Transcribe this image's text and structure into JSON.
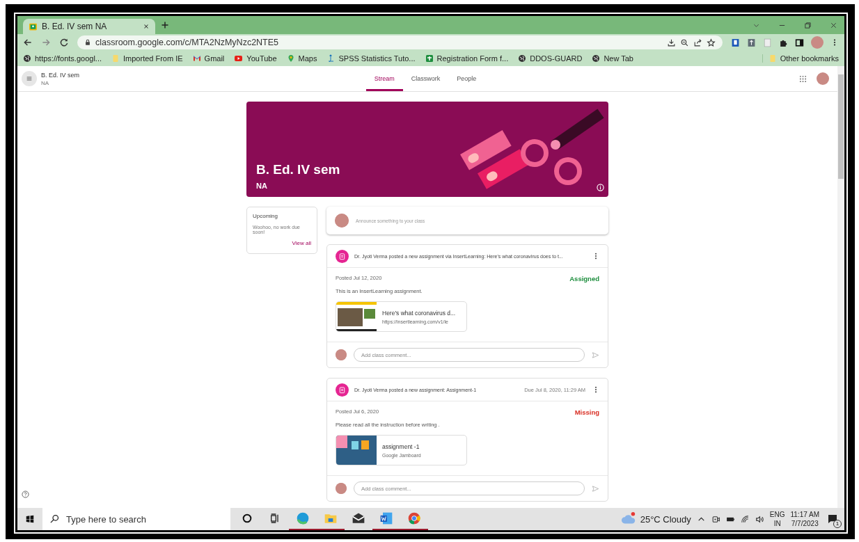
{
  "browser": {
    "tabs": [
      {
        "title": "B. Ed. IV sem NA",
        "selected": true
      }
    ],
    "url": "classroom.google.com/c/MTA2NzMyNzc2NTE5",
    "bookmarks": [
      {
        "label": "https://fonts.googl...",
        "kind": "globe"
      },
      {
        "label": "Imported From IE",
        "kind": "folder"
      },
      {
        "label": "Gmail",
        "kind": "gmail"
      },
      {
        "label": "YouTube",
        "kind": "youtube"
      },
      {
        "label": "Maps",
        "kind": "maps"
      },
      {
        "label": "SPSS Statistics Tuto...",
        "kind": "spss"
      },
      {
        "label": "Registration Form f...",
        "kind": "forms"
      },
      {
        "label": "DDOS-GUARD",
        "kind": "globe"
      },
      {
        "label": "New Tab",
        "kind": "globe"
      }
    ],
    "other_bookmarks": "Other bookmarks"
  },
  "app": {
    "class_name": "B. Ed. IV sem",
    "section": "NA",
    "nav_tabs": [
      {
        "label": "Stream",
        "selected": true
      },
      {
        "label": "Classwork",
        "selected": false
      },
      {
        "label": "People",
        "selected": false
      }
    ]
  },
  "banner": {
    "title": "B. Ed. IV sem",
    "section": "NA"
  },
  "upcoming": {
    "title": "Upcoming",
    "message": "Woohoo, no work due soon!",
    "link": "View all"
  },
  "announce": {
    "placeholder": "Announce something to your class"
  },
  "posts": [
    {
      "title": "Dr. Jyoti Verma posted a new assignment via InsertLearning: Here's what coronavirus does to t...",
      "posted": "Posted Jul 12, 2020",
      "status": "Assigned",
      "color": "#1e8e3e",
      "description": "This is an InsertLearning assignment.",
      "attachment": {
        "kind": "web",
        "title": "Here's what coronavirus d...",
        "subtitle": "https://insertlearning.com/v1/le"
      },
      "comment_placeholder": "Add class comment..."
    },
    {
      "title": "Dr. Jyoti Verma posted a new assignment: Assignment-1",
      "due": "Due Jul 8, 2020, 11:29 AM",
      "posted": "Posted Jul 6, 2020",
      "status": "Missing",
      "color": "#d93025",
      "description": "Please read all the instruction before writing .",
      "attachment": {
        "kind": "jamboard",
        "title": "assignment -1",
        "subtitle": "Google Jamboard"
      },
      "comment_placeholder": "Add class comment..."
    }
  ],
  "taskbar": {
    "search_placeholder": "Type here to search",
    "weather": "25°C  Cloudy",
    "language": "ENG",
    "region": "IN",
    "time": "11:17 AM",
    "date": "7/7/2023",
    "notifications": "1"
  }
}
